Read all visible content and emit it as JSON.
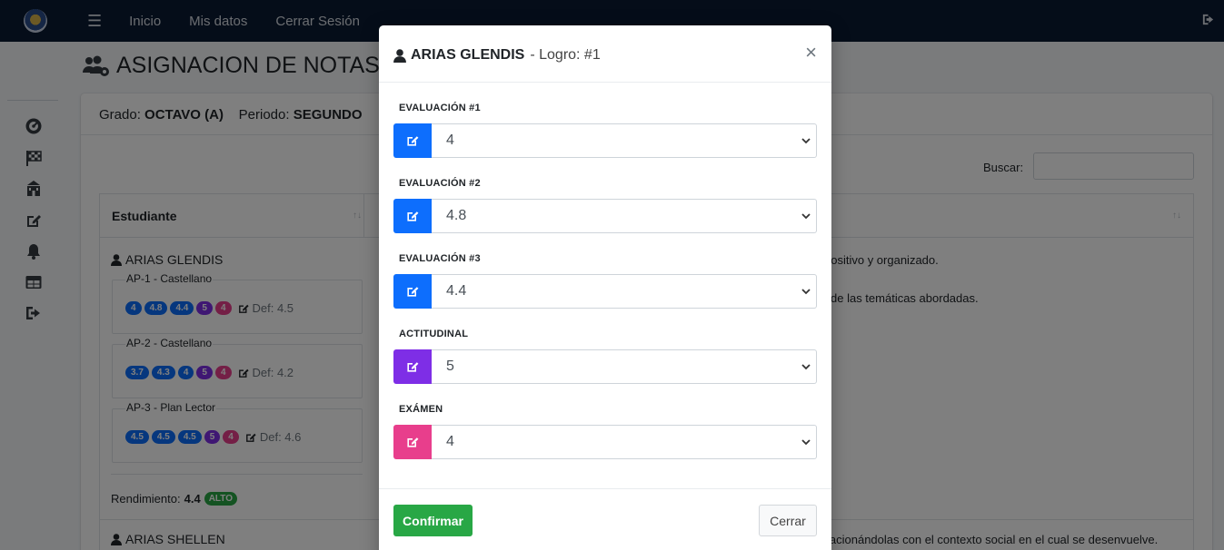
{
  "navbar": {
    "links": [
      "Inicio",
      "Mis datos",
      "Cerrar Sesión"
    ]
  },
  "page": {
    "title": "ASIGNACION DE NOTAS",
    "grado_label": "Grado:",
    "grado_value": "OCTAVO (A)",
    "periodo_label": "Periodo:",
    "periodo_value": "SEGUNDO",
    "search_label": "Buscar:",
    "table_header": "Estudiante"
  },
  "students": [
    {
      "name": "ARIAS GLENDIS",
      "achievements": [
        {
          "legend": "AP-1 - Castellano",
          "grades": [
            "4",
            "4.8",
            "4.4",
            "5",
            "4"
          ],
          "def": "Def: 4.5"
        },
        {
          "legend": "AP-2 - Castellano",
          "grades": [
            "3.7",
            "4.3",
            "4",
            "5",
            "4"
          ],
          "def": "Def: 4.2"
        },
        {
          "legend": "AP-3 - Plan Lector",
          "grades": [
            "4.5",
            "4.5",
            "4.5",
            "5",
            "4"
          ],
          "def": "Def: 4.6"
        }
      ],
      "rendimiento_label": "Rendimiento:",
      "rendimiento_value": "4.4",
      "rendimiento_badge": "ALTO",
      "observations": [
        "positivo y organizado.",
        "de las temáticas abordadas."
      ]
    },
    {
      "name": "ARIAS SHELLEN",
      "observation": "lacionándolas con el contexto social en el cual se desenvuelve."
    }
  ],
  "modal": {
    "student": "ARIAS GLENDIS",
    "subtitle": "- Logro: #1",
    "fields": [
      {
        "label": "EVALUACIÓN #1",
        "value": "4",
        "color": "#0d6efd"
      },
      {
        "label": "EVALUACIÓN #2",
        "value": "4.8",
        "color": "#0d6efd"
      },
      {
        "label": "EVALUACIÓN #3",
        "value": "4.4",
        "color": "#0d6efd"
      },
      {
        "label": "ACTITUDINAL",
        "value": "5",
        "color": "#7e2ee6"
      },
      {
        "label": "EXÁMEN",
        "value": "4",
        "color": "#e83e8c"
      }
    ],
    "confirm_label": "Confirmar",
    "close_label": "Cerrar"
  },
  "colors": {
    "navbar": "#0b1b33",
    "success": "#28a745",
    "primary": "#0d6efd",
    "purple": "#7e2ee6",
    "pink": "#e83e8c"
  },
  "icons": {
    "sidebar": [
      "dashboard-icon",
      "flag-checkered-icon",
      "school-icon",
      "edit-icon",
      "bell-icon",
      "table-icon",
      "sign-out-icon"
    ]
  }
}
